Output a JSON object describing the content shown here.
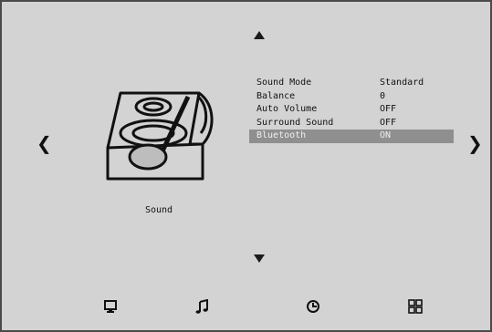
{
  "screen": {
    "menu_title": "Sound",
    "items": [
      {
        "label": "Sound Mode",
        "value": "Standard"
      },
      {
        "label": "Balance",
        "value": "0"
      },
      {
        "label": "Auto Volume",
        "value": "OFF"
      },
      {
        "label": "Surround Sound",
        "value": "OFF"
      },
      {
        "label": "Bluetooth",
        "value": "ON"
      }
    ],
    "selected_index": 4,
    "nav": {
      "left": "❮",
      "right": "❯"
    },
    "bottom_icons": [
      "picture-icon",
      "music-note-icon",
      "clock-icon",
      "grid-icon"
    ]
  }
}
